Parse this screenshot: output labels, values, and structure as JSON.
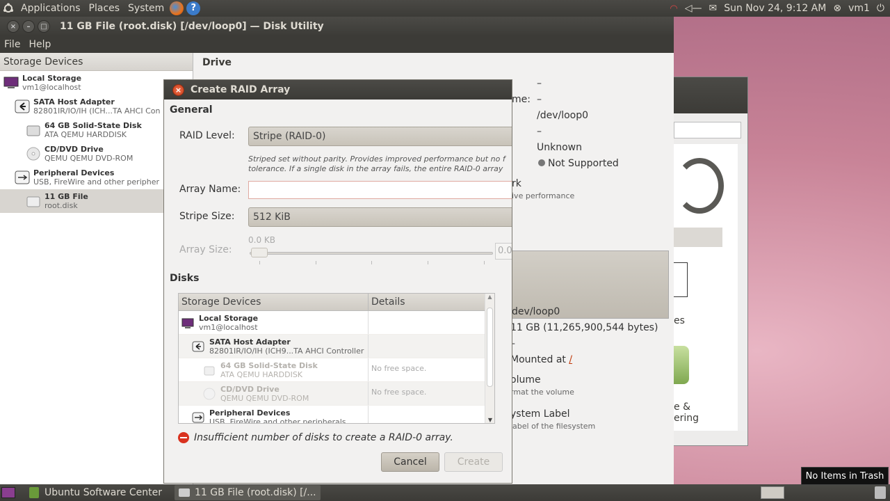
{
  "top_panel": {
    "menus": [
      "Applications",
      "Places",
      "System"
    ],
    "datetime": "Sun Nov 24,  9:12 AM",
    "user": "vm1"
  },
  "main_window": {
    "title": "11 GB File (root.disk) [/dev/loop0] — Disk Utility",
    "menu": [
      "File",
      "Help"
    ],
    "sidebar_header": "Storage Devices",
    "tree": [
      {
        "name": "Local Storage",
        "sub": "vm1@localhost"
      },
      {
        "name": "SATA Host Adapter",
        "sub": "82801IR/IO/IH (ICH...TA AHCI Con"
      },
      {
        "name": "64 GB Solid-State Disk",
        "sub": "ATA QEMU HARDDISK"
      },
      {
        "name": "CD/DVD Drive",
        "sub": "QEMU QEMU DVD-ROM"
      },
      {
        "name": "Peripheral Devices",
        "sub": "USB, FireWire and other peripher"
      },
      {
        "name": "11 GB File",
        "sub": "root.disk"
      }
    ],
    "drive_section": "Drive",
    "drive_values": [
      "–",
      "me:",
      "–",
      "/dev/loop0",
      "–",
      "Unknown",
      "Not Supported",
      "rk",
      "ive performance"
    ],
    "volume_values": [
      "dev/loop0",
      "11 GB (11,265,900,544 bytes)",
      "–",
      "Mounted at",
      "/",
      "olume",
      "rmat the volume",
      "ystem Label",
      "label of the filesystem"
    ]
  },
  "software_center_fragments": [
    "es",
    "e &",
    "ering"
  ],
  "dialog": {
    "title": "Create RAID Array",
    "general_label": "General",
    "raid_level_label": "RAID Level:",
    "raid_level_value": "Stripe (RAID-0)",
    "raid_hint_1": "Striped set without parity. Provides improved performance but no f",
    "raid_hint_2": "tolerance. If a single disk in the array fails, the entire RAID-0 array",
    "array_name_label": "Array Name:",
    "array_name_value": "",
    "stripe_size_label": "Stripe Size:",
    "stripe_size_value": "512 KiB",
    "array_size_label": "Array Size:",
    "array_size_value": "0.0 KB",
    "array_size_box": "0.0",
    "disks_label": "Disks",
    "table_headers": [
      "Storage Devices",
      "Details"
    ],
    "table_rows": [
      {
        "name": "Local Storage",
        "sub": "vm1@localhost",
        "details": ""
      },
      {
        "name": "SATA Host Adapter",
        "sub": "82801IR/IO/IH (ICH9...TA AHCI Controller",
        "details": ""
      },
      {
        "name": "64 GB Solid-State Disk",
        "sub": "ATA QEMU HARDDISK",
        "details": "No free space."
      },
      {
        "name": "CD/DVD Drive",
        "sub": "QEMU QEMU DVD-ROM",
        "details": "No free space."
      },
      {
        "name": "Peripheral Devices",
        "sub": "USB, FireWire and other peripherals",
        "details": ""
      }
    ],
    "error_text": "Insufficient number of disks to create a RAID-0 array.",
    "cancel_label": "Cancel",
    "create_label": "Create"
  },
  "bottom_panel": {
    "tasks": [
      "Ubuntu Software Center",
      "11 GB File (root.disk) [/..."
    ],
    "trash_tooltip": "No Items in Trash"
  },
  "colors": {
    "panel": "#3c3b37",
    "error": "#d9321f",
    "accent": "#f26d49"
  }
}
